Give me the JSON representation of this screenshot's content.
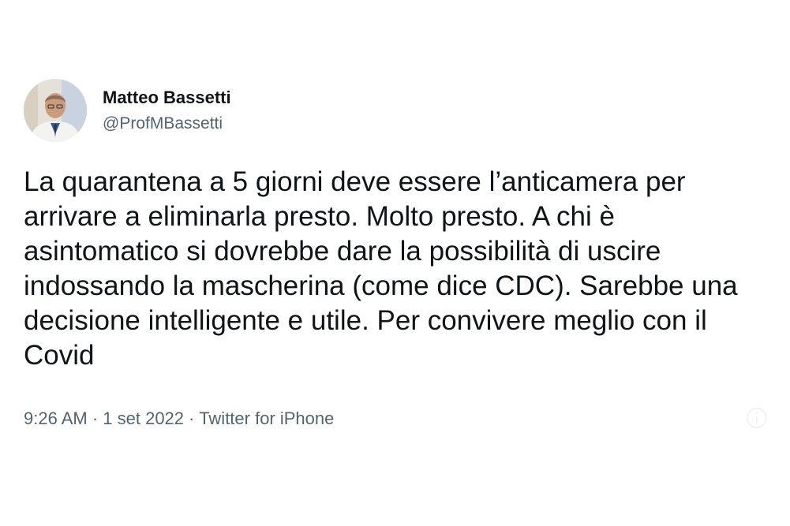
{
  "tweet": {
    "author_name": "Matteo Bassetti",
    "author_handle": "@ProfMBassetti",
    "text": "La quarantena a 5 giorni deve essere l’anticamera per arrivare a eliminarla presto. Molto presto. A chi è asintomatico si dovrebbe dare la possibilità di uscire indossando la mascherina (come dice CDC). Sarebbe una decisione intelligente e utile. Per convivere meglio con il Covid",
    "time": "9:26 AM",
    "separator": " · ",
    "date": "1 set 2022",
    "source": "Twitter for iPhone"
  },
  "colors": {
    "text_primary": "#0f1419",
    "text_secondary": "#536471",
    "background": "#ffffff"
  },
  "icons": {
    "avatar": "profile-photo",
    "corner": "info-icon"
  }
}
